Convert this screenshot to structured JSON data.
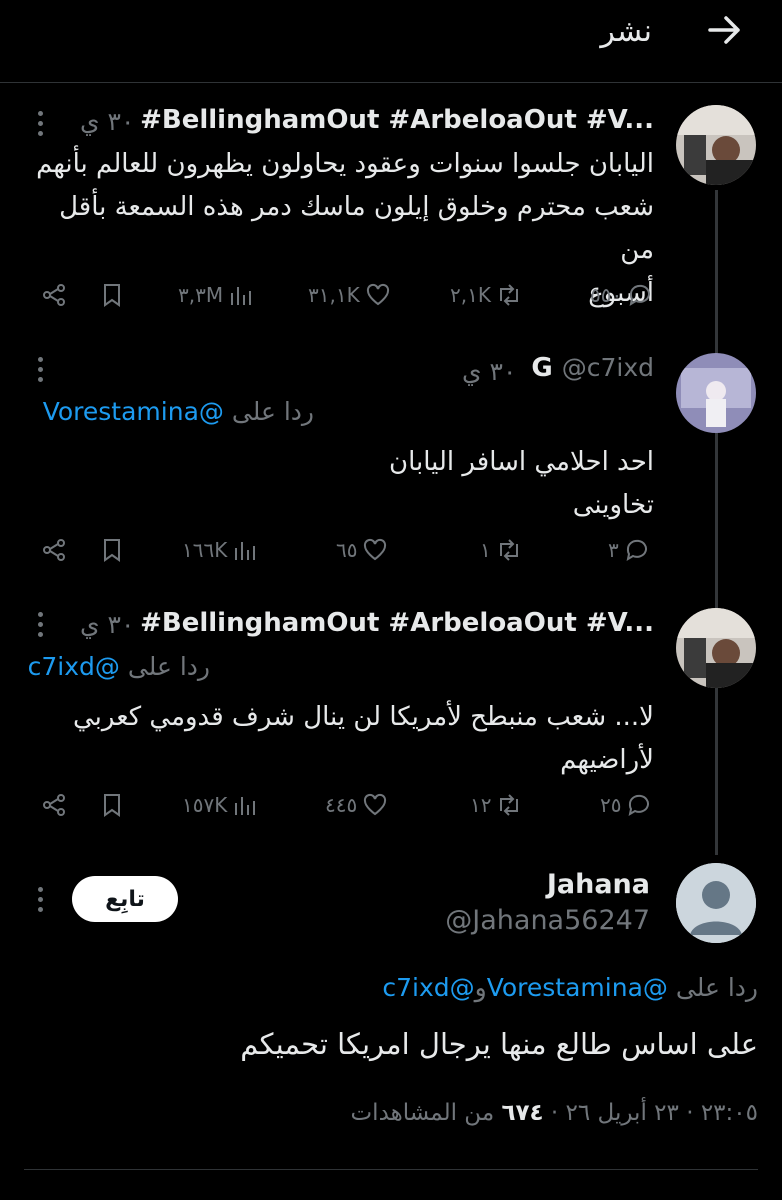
{
  "header": {
    "title": "نشر"
  },
  "tweets": [
    {
      "author": "#BellinghamOut #ArbeloaOut #V...",
      "time": "٣٠ ي",
      "lines": [
        "اليابان جلسوا سنوات وعقود يحاولون يظهرون للعالم بأنهم",
        "شعب محترم وخلوق إيلون ماسك دمر هذه السمعة بأقل من",
        "أسبوع"
      ],
      "replies": "٥٥٠",
      "retweets": "٢,١K",
      "likes": "٣١,١K",
      "views": "٣,٣M"
    },
    {
      "author": "G",
      "handle": "@c7ixd",
      "time": "٣٠ ي",
      "reply_label": "ردا على",
      "reply_mention": "@Vorestamina",
      "lines": [
        "احد احلامي اسافر اليابان",
        "تخاوينى"
      ],
      "replies": "٣",
      "retweets": "١",
      "likes": "٦٥",
      "views": "١٦٦K"
    },
    {
      "author": "#BellinghamOut #ArbeloaOut #V...",
      "time": "٣٠ ي",
      "reply_label": "ردا على",
      "reply_mention": "@c7ixd",
      "lines": [
        "لا... شعب منبطح لأمريكا لن ينال شرف قدومي كعربي",
        "لأراضيهم"
      ],
      "replies": "٢٥",
      "retweets": "١٢",
      "likes": "٤٤٥",
      "views": "١٥٧K"
    }
  ],
  "main": {
    "name": "Jahana",
    "handle": "@Jahana56247",
    "follow_label": "تابِع",
    "reply_label": "ردا على",
    "mention1": "@Vorestamina",
    "conj": "و",
    "mention2": "@c7ixd",
    "text": "على اساس طالع منها يرجال امريكا تحميكم",
    "time": "٢٣:٠٥",
    "date": "٢٣ أبريل ٢٦",
    "views_count": "٦٧٤",
    "views_label": "من المشاهدات",
    "dot": "·"
  },
  "colors": {
    "accent": "#1d9bf0",
    "muted": "#71767b",
    "text": "#e7e9ea",
    "bg": "#000000"
  }
}
